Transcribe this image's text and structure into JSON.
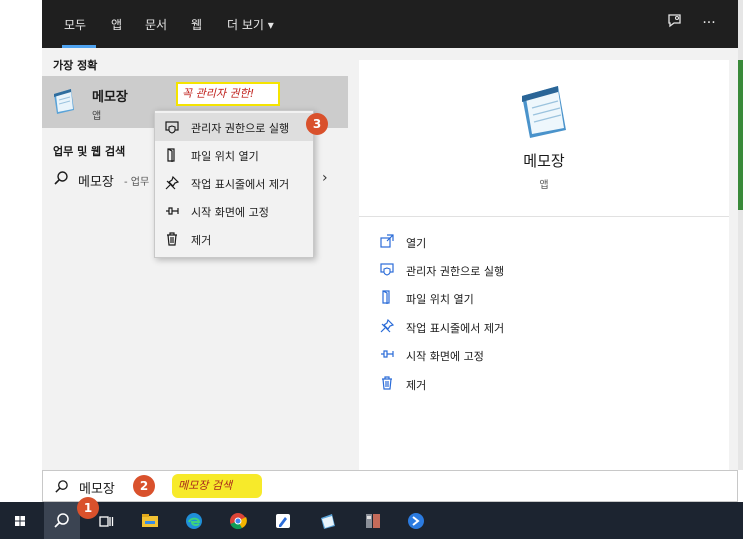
{
  "search_window": {
    "tabs": [
      {
        "label": "모두"
      },
      {
        "label": "앱"
      },
      {
        "label": "문서"
      },
      {
        "label": "웹"
      },
      {
        "label": "더 보기 ▾"
      }
    ],
    "more_icon": "···",
    "best_match_header": "가장 정확",
    "best_match": {
      "title": "메모장",
      "subtitle": "앱"
    },
    "web_header": "업무 및 웹 검색",
    "web_result": {
      "label": "메모장",
      "suffix": "- 업무"
    },
    "annotation_admin": "꼭 관리자 권한!"
  },
  "context_menu": {
    "items": [
      {
        "icon": "shield-icon",
        "label": "관리자 권한으로 실행"
      },
      {
        "icon": "folder-icon",
        "label": "파일 위치 열기"
      },
      {
        "icon": "unpin-icon",
        "label": "작업 표시줄에서 제거"
      },
      {
        "icon": "pin-icon",
        "label": "시작 화면에 고정"
      },
      {
        "icon": "trash-icon",
        "label": "제거"
      }
    ]
  },
  "preview": {
    "title": "메모장",
    "subtitle": "앱",
    "actions": [
      {
        "icon": "open-icon",
        "label": "열기"
      },
      {
        "icon": "shield-icon",
        "label": "관리자 권한으로 실행"
      },
      {
        "icon": "folder-icon",
        "label": "파일 위치 열기"
      },
      {
        "icon": "unpin-icon",
        "label": "작업 표시줄에서 제거"
      },
      {
        "icon": "pin-icon",
        "label": "시작 화면에 고정"
      },
      {
        "icon": "trash-icon",
        "label": "제거"
      }
    ]
  },
  "searchbox": {
    "value": "메모장",
    "annotation": "메모장 검색"
  },
  "markers": [
    "1",
    "2",
    "3"
  ],
  "taskbar": {
    "items": [
      "windows-icon",
      "search-icon",
      "task-view-icon",
      "file-explorer-icon",
      "edge-icon",
      "chrome-icon",
      "app-icon",
      "notepad-icon",
      "app-icon",
      "app-icon"
    ]
  },
  "colors": {
    "accent": "#4fa3f0",
    "marker": "#d9512c",
    "highlight": "#f7ea2a",
    "annotation_text": "#c0221d",
    "taskbar": "#1c2430",
    "topbar": "#1f1f1f"
  }
}
